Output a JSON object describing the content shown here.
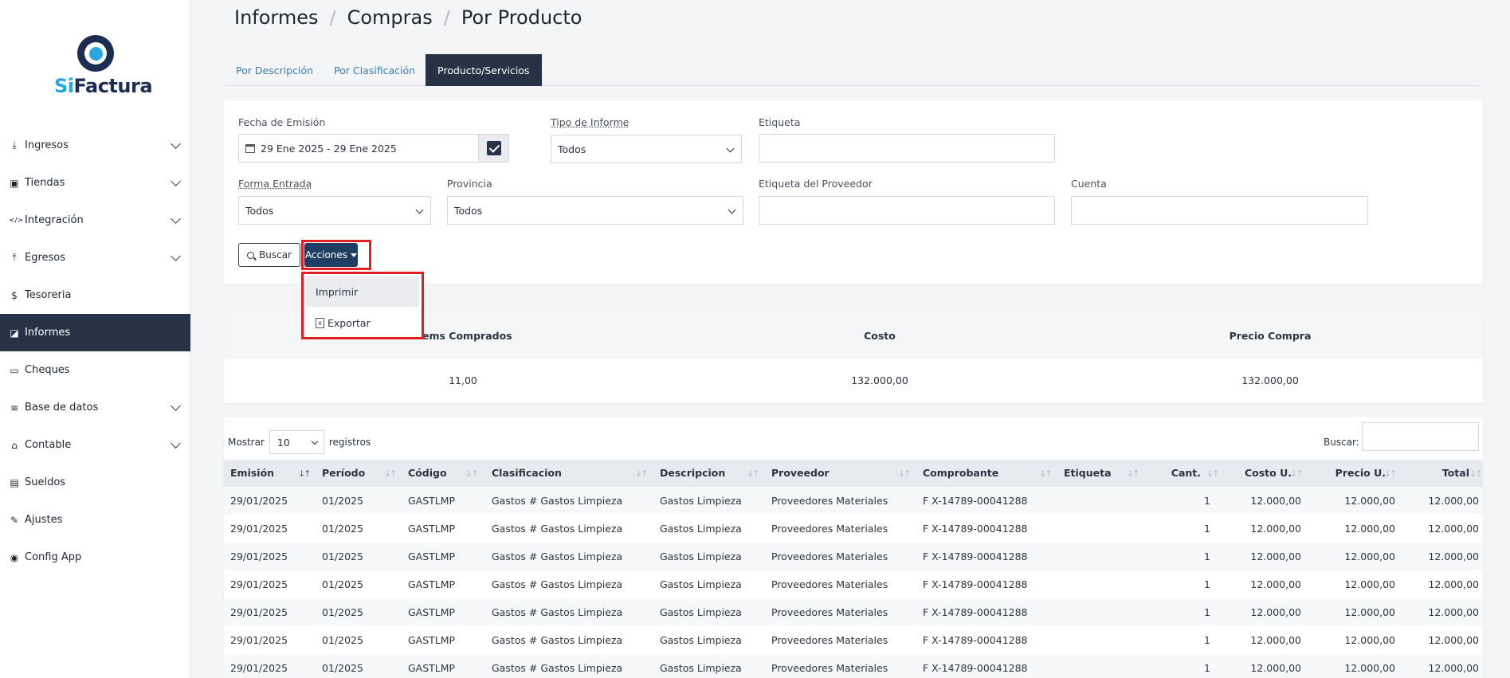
{
  "app": {
    "logo_si": "Si",
    "logo_rest": "Factura"
  },
  "sidebar": {
    "items": [
      {
        "label": "Ingresos",
        "icon": "download-icon",
        "glyph": "⤓",
        "chevron": true,
        "active": false
      },
      {
        "label": "Tiendas",
        "icon": "shopping-bag-icon",
        "glyph": "▣",
        "chevron": true,
        "active": false
      },
      {
        "label": "Integración",
        "icon": "code-icon",
        "glyph": "</>",
        "chevron": true,
        "active": false
      },
      {
        "label": "Egresos",
        "icon": "upload-icon",
        "glyph": "⤒",
        "chevron": true,
        "active": false
      },
      {
        "label": "Tesoreria",
        "icon": "dollar-icon",
        "glyph": "$",
        "chevron": false,
        "active": false
      },
      {
        "label": "Informes",
        "icon": "chart-icon",
        "glyph": "◪",
        "chevron": false,
        "active": true
      },
      {
        "label": "Cheques",
        "icon": "credit-card-icon",
        "glyph": "▭",
        "chevron": false,
        "active": false
      },
      {
        "label": "Base de datos",
        "icon": "database-icon",
        "glyph": "≡",
        "chevron": true,
        "active": false
      },
      {
        "label": "Contable",
        "icon": "bank-icon",
        "glyph": "⌂",
        "chevron": true,
        "active": false
      },
      {
        "label": "Sueldos",
        "icon": "book-icon",
        "glyph": "▤",
        "chevron": false,
        "active": false
      },
      {
        "label": "Ajustes",
        "icon": "wrench-icon",
        "glyph": "✎",
        "chevron": false,
        "active": false
      },
      {
        "label": "Config App",
        "icon": "palette-icon",
        "glyph": "◉",
        "chevron": false,
        "active": false
      }
    ]
  },
  "breadcrumb": [
    "Informes",
    "Compras",
    "Por Producto"
  ],
  "tabs": [
    {
      "label": "Por Descripción",
      "active": false
    },
    {
      "label": "Por Clasificación",
      "active": false
    },
    {
      "label": "Producto/Servicios",
      "active": true
    }
  ],
  "filters": {
    "fecha_label": "Fecha de Emisión",
    "fecha_value": "29 Ene 2025 - 29 Ene 2025",
    "tipo_label": "Tipo de Informe",
    "tipo_value": "Todos",
    "etiqueta_label": "Etiqueta",
    "etiqueta_value": "",
    "forma_label": "Forma Entrada",
    "forma_value": "Todos",
    "provincia_label": "Provincia",
    "provincia_value": "Todos",
    "etiqueta_prov_label": "Etiqueta del Proveedor",
    "etiqueta_prov_value": "",
    "cuenta_label": "Cuenta",
    "cuenta_value": "",
    "buscar_button": "Buscar",
    "acciones_button": "Acciones"
  },
  "actions_menu": [
    "Imprimir",
    "Exportar"
  ],
  "summary": {
    "headers": [
      "Items Comprados",
      "Costo",
      "Precio Compra"
    ],
    "values": [
      "11,00",
      "132.000,00",
      "132.000,00"
    ]
  },
  "table": {
    "show_label": "Mostrar",
    "show_value": "10",
    "show_suffix": "registros",
    "search_label": "Buscar:",
    "columns": [
      "Emisión",
      "Período",
      "Código",
      "Clasificacion",
      "Descripcion",
      "Proveedor",
      "Comprobante",
      "Etiqueta",
      "Cant.",
      "Costo U.",
      "Precio U.",
      "Total"
    ],
    "rows": [
      [
        "29/01/2025",
        "01/2025",
        "GASTLMP",
        "Gastos # Gastos Limpieza",
        "Gastos Limpieza",
        "Proveedores Materiales",
        "F X-14789-00041288",
        "",
        "1",
        "12.000,00",
        "12.000,00",
        "12.000,00"
      ],
      [
        "29/01/2025",
        "01/2025",
        "GASTLMP",
        "Gastos # Gastos Limpieza",
        "Gastos Limpieza",
        "Proveedores Materiales",
        "F X-14789-00041288",
        "",
        "1",
        "12.000,00",
        "12.000,00",
        "12.000,00"
      ],
      [
        "29/01/2025",
        "01/2025",
        "GASTLMP",
        "Gastos # Gastos Limpieza",
        "Gastos Limpieza",
        "Proveedores Materiales",
        "F X-14789-00041288",
        "",
        "1",
        "12.000,00",
        "12.000,00",
        "12.000,00"
      ],
      [
        "29/01/2025",
        "01/2025",
        "GASTLMP",
        "Gastos # Gastos Limpieza",
        "Gastos Limpieza",
        "Proveedores Materiales",
        "F X-14789-00041288",
        "",
        "1",
        "12.000,00",
        "12.000,00",
        "12.000,00"
      ],
      [
        "29/01/2025",
        "01/2025",
        "GASTLMP",
        "Gastos # Gastos Limpieza",
        "Gastos Limpieza",
        "Proveedores Materiales",
        "F X-14789-00041288",
        "",
        "1",
        "12.000,00",
        "12.000,00",
        "12.000,00"
      ],
      [
        "29/01/2025",
        "01/2025",
        "GASTLMP",
        "Gastos # Gastos Limpieza",
        "Gastos Limpieza",
        "Proveedores Materiales",
        "F X-14789-00041288",
        "",
        "1",
        "12.000,00",
        "12.000,00",
        "12.000,00"
      ],
      [
        "29/01/2025",
        "01/2025",
        "GASTLMP",
        "Gastos # Gastos Limpieza",
        "Gastos Limpieza",
        "Proveedores Materiales",
        "F X-14789-00041288",
        "",
        "1",
        "12.000,00",
        "12.000,00",
        "12.000,00"
      ]
    ]
  },
  "colors": {
    "primary": "#263346",
    "accent": "#29a8e0",
    "highlight": "#e02020"
  }
}
